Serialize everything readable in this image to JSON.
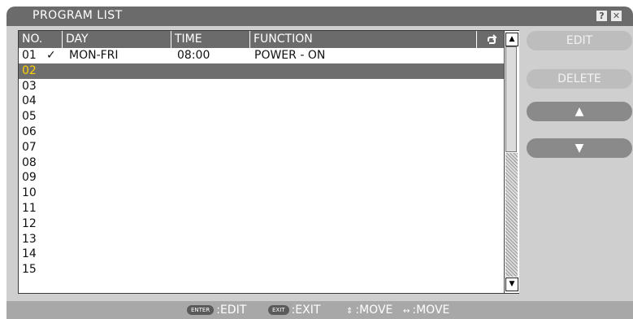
{
  "window": {
    "title": "PROGRAM LIST",
    "help_icon": "?",
    "close_icon": "✕"
  },
  "table": {
    "headers": {
      "no": "NO.",
      "day": "DAY",
      "time": "TIME",
      "function": "FUNCTION"
    },
    "repeat_icon": "repeat-icon",
    "rows": [
      {
        "no": "01",
        "check": "✓",
        "day": "MON-FRI",
        "time": "08:00",
        "function": "POWER - ON"
      },
      {
        "no": "02",
        "check": "",
        "day": "",
        "time": "",
        "function": ""
      },
      {
        "no": "03",
        "check": "",
        "day": "",
        "time": "",
        "function": ""
      },
      {
        "no": "04",
        "check": "",
        "day": "",
        "time": "",
        "function": ""
      },
      {
        "no": "05",
        "check": "",
        "day": "",
        "time": "",
        "function": ""
      },
      {
        "no": "06",
        "check": "",
        "day": "",
        "time": "",
        "function": ""
      },
      {
        "no": "07",
        "check": "",
        "day": "",
        "time": "",
        "function": ""
      },
      {
        "no": "08",
        "check": "",
        "day": "",
        "time": "",
        "function": ""
      },
      {
        "no": "09",
        "check": "",
        "day": "",
        "time": "",
        "function": ""
      },
      {
        "no": "10",
        "check": "",
        "day": "",
        "time": "",
        "function": ""
      },
      {
        "no": "11",
        "check": "",
        "day": "",
        "time": "",
        "function": ""
      },
      {
        "no": "12",
        "check": "",
        "day": "",
        "time": "",
        "function": ""
      },
      {
        "no": "13",
        "check": "",
        "day": "",
        "time": "",
        "function": ""
      },
      {
        "no": "14",
        "check": "",
        "day": "",
        "time": "",
        "function": ""
      },
      {
        "no": "15",
        "check": "",
        "day": "",
        "time": "",
        "function": ""
      }
    ],
    "selected_index": 1
  },
  "buttons": {
    "edit": "EDIT",
    "delete": "DELETE",
    "up": "▲",
    "down": "▼"
  },
  "footer": {
    "enter_key": "ENTER",
    "enter_action": ":EDIT",
    "exit_key": "EXIT",
    "exit_action": ":EXIT",
    "move_vertical_glyph": "⇕",
    "move_vertical": ":MOVE",
    "move_horizontal_glyph": "↔",
    "move_horizontal": ":MOVE"
  },
  "colors": {
    "titlebar": "#6b6b6b",
    "selected_row": "#6e6e6e",
    "selected_text": "#ffd000",
    "panel": "#cfcfcf"
  }
}
